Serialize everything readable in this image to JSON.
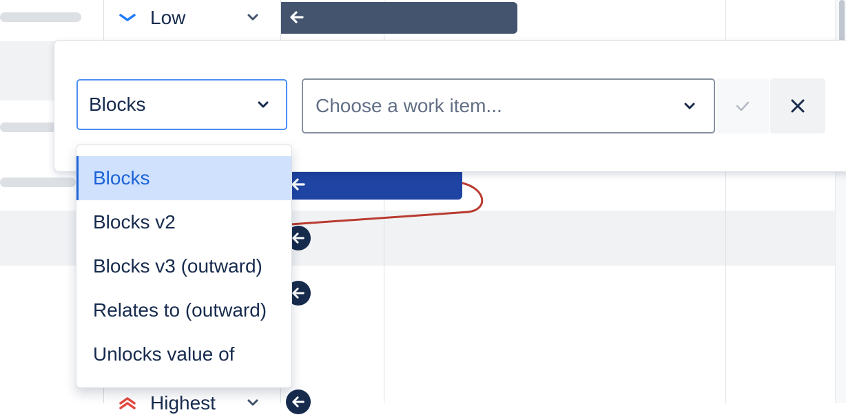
{
  "background_rows": {
    "top_priority": {
      "label": "Low",
      "icon": "chevron-low-icon",
      "color": "#1d7afc"
    },
    "bottom_priority": {
      "label": "Highest",
      "icon": "chevron-highest-icon",
      "color": "#e2483d"
    }
  },
  "link_form": {
    "link_type": {
      "value": "Blocks",
      "icon": "chevron-down-icon"
    },
    "work_item": {
      "placeholder": "Choose a work item...",
      "icon": "chevron-down-icon"
    },
    "confirm_icon": "check-icon",
    "cancel_icon": "close-icon"
  },
  "link_type_menu": {
    "options": [
      {
        "label": "Blocks",
        "selected": true
      },
      {
        "label": "Blocks v2",
        "selected": false
      },
      {
        "label": "Blocks v3 (outward)",
        "selected": false
      },
      {
        "label": "Relates to (outward)",
        "selected": false
      },
      {
        "label": "Unlocks value of",
        "selected": false
      }
    ]
  },
  "colors": {
    "accent": "#1d63d8",
    "selected_bg": "#cfe1fd",
    "bar_dark": "#44546f",
    "bar_blue": "#1f44a3",
    "dependency_line": "#c0392b"
  }
}
